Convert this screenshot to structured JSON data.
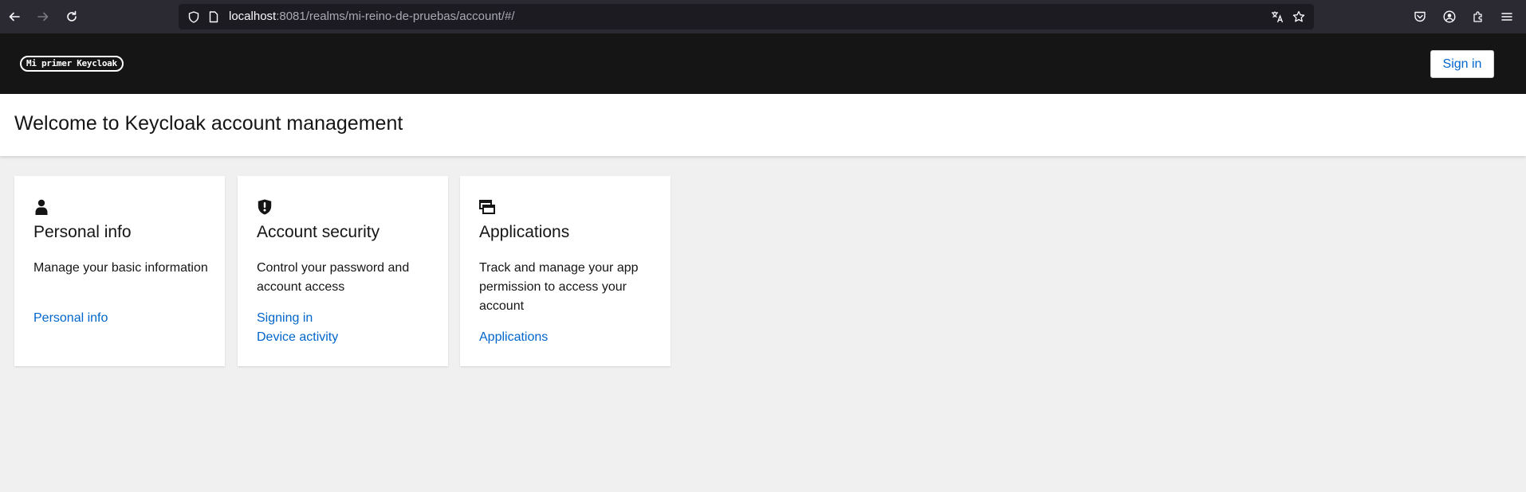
{
  "browser": {
    "url_host": "localhost",
    "url_rest": ":8081/realms/mi-reino-de-pruebas/account/#/"
  },
  "header": {
    "brand_text": "Mi primer Keycloak",
    "signin_label": "Sign in"
  },
  "page": {
    "title": "Welcome to Keycloak account management"
  },
  "cards": [
    {
      "icon": "user-icon",
      "title": "Personal info",
      "description": "Manage your basic information",
      "links": [
        "Personal info"
      ]
    },
    {
      "icon": "shield-alert-icon",
      "title": "Account security",
      "description": "Control your password and account access",
      "links": [
        "Signing in",
        "Device activity"
      ]
    },
    {
      "icon": "windows-icon",
      "title": "Applications",
      "description": "Track and manage your app permission to access your account",
      "links": [
        "Applications"
      ]
    }
  ],
  "colors": {
    "header_bg": "#151515",
    "link": "#0066cc",
    "page_bg": "#f0f0f0"
  }
}
